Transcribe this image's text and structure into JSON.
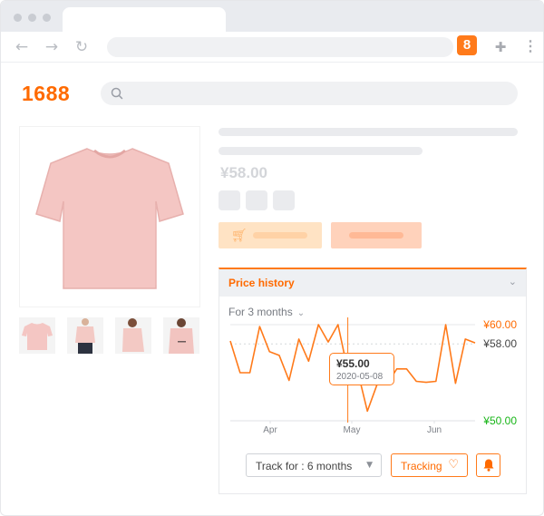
{
  "extension": {
    "badge_text": "8"
  },
  "site": {
    "logo": "1688"
  },
  "product": {
    "price": "¥58.00"
  },
  "price_history": {
    "title": "Price history",
    "period_label": "For 3 months",
    "tooltip": {
      "price": "¥55.00",
      "date": "2020-05-08"
    },
    "track_select_label": "Track for : 6 months",
    "tracking_label": "Tracking",
    "icons": {
      "collapse": "chevron-down-icon",
      "heart": "heart-icon",
      "bell": "bell-icon"
    }
  },
  "chart_data": {
    "type": "line",
    "x_labels": [
      "Apr",
      "May",
      "Jun"
    ],
    "y_labels": [
      {
        "value": 60,
        "text": "¥60.00",
        "color": "#ff6a00"
      },
      {
        "value": 58,
        "text": "¥58.00",
        "color": "#444444"
      },
      {
        "value": 50,
        "text": "¥50.00",
        "color": "#17b517"
      }
    ],
    "ylim": [
      50,
      60
    ],
    "series": [
      {
        "color": "#ff7a1a",
        "values": [
          58.3,
          55.0,
          55.0,
          59.8,
          57.2,
          56.8,
          54.2,
          58.5,
          56.2,
          60.0,
          58.2,
          60.0,
          55.2,
          55.2,
          51.0,
          53.8,
          53.8,
          55.4,
          55.4,
          54.1,
          54.0,
          54.1,
          60.0,
          53.9,
          58.5,
          58.1
        ]
      }
    ],
    "highlight_index": 12,
    "colors": {
      "line": "#ff7a1a",
      "max": "#ff6a00",
      "min": "#17b517"
    }
  }
}
